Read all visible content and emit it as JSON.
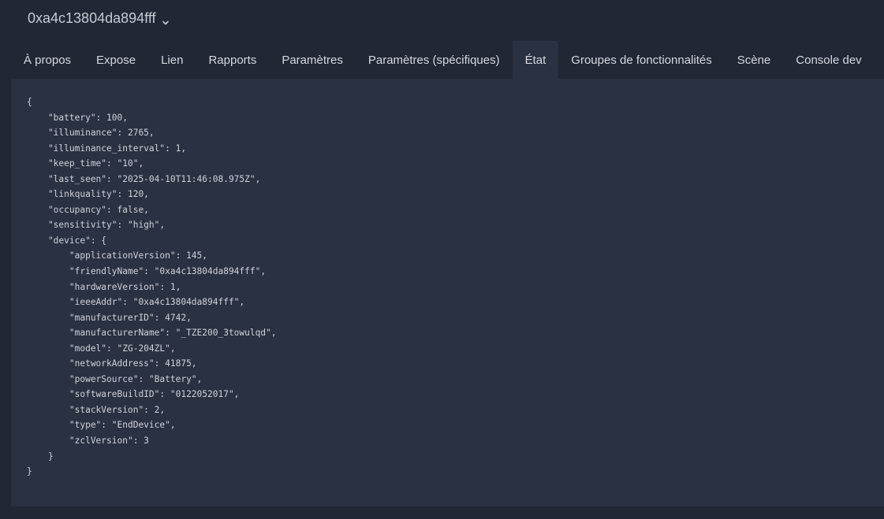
{
  "header": {
    "device_name": "0xa4c13804da894fff",
    "chevron_icon": "chevron-down-icon"
  },
  "tabs": [
    {
      "label": "À propos",
      "active": false
    },
    {
      "label": "Expose",
      "active": false
    },
    {
      "label": "Lien",
      "active": false
    },
    {
      "label": "Rapports",
      "active": false
    },
    {
      "label": "Paramètres",
      "active": false
    },
    {
      "label": "Paramètres (spécifiques)",
      "active": false
    },
    {
      "label": "État",
      "active": true
    },
    {
      "label": "Groupes de fonctionnalités",
      "active": false
    },
    {
      "label": "Scène",
      "active": false
    },
    {
      "label": "Console dev",
      "active": false
    }
  ],
  "state": {
    "lines": [
      "{",
      "    \"battery\": 100,",
      "    \"illuminance\": 2765,",
      "    \"illuminance_interval\": 1,",
      "    \"keep_time\": \"10\",",
      "    \"last_seen\": \"2025-04-10T11:46:08.975Z\",",
      "    \"linkquality\": 120,",
      "    \"occupancy\": false,",
      "    \"sensitivity\": \"high\",",
      "    \"device\": {",
      "        \"applicationVersion\": 145,",
      "        \"friendlyName\": \"0xa4c13804da894fff\",",
      "        \"hardwareVersion\": 1,",
      "        \"ieeeAddr\": \"0xa4c13804da894fff\",",
      "        \"manufacturerID\": 4742,",
      "        \"manufacturerName\": \"_TZE200_3towulqd\",",
      "        \"model\": \"ZG-204ZL\",",
      "        \"networkAddress\": 41875,",
      "        \"powerSource\": \"Battery\",",
      "        \"softwareBuildID\": \"0122052017\",",
      "        \"stackVersion\": 2,",
      "        \"type\": \"EndDevice\",",
      "        \"zclVersion\": 3",
      "    }",
      "}"
    ]
  },
  "colors": {
    "background": "#222735",
    "panel": "#2a3141",
    "text": "#cfd3db"
  }
}
